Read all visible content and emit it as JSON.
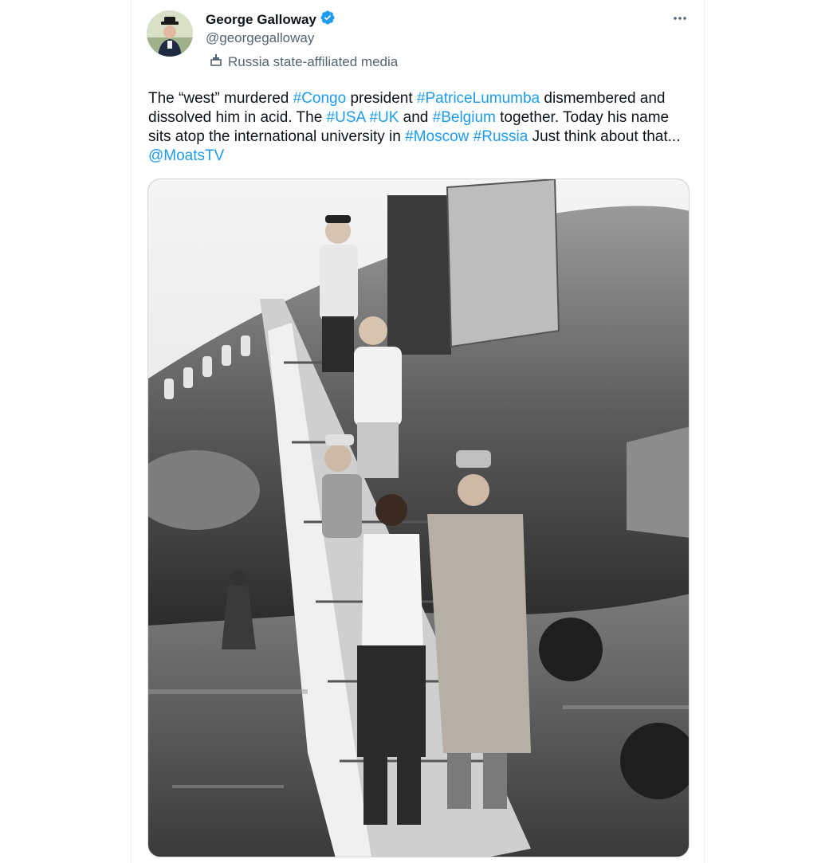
{
  "author": {
    "display_name": "George Galloway",
    "handle": "@georgegalloway",
    "verified": true,
    "affiliation": "Russia state-affiliated media",
    "affiliation_icon": "podium-icon"
  },
  "more_icon": "more-horizontal-icon",
  "tweet": {
    "segments": [
      {
        "text": "The “west” murdered ",
        "tag": false
      },
      {
        "text": "#Congo",
        "tag": true
      },
      {
        "text": " president ",
        "tag": false
      },
      {
        "text": "#PatriceLumumba",
        "tag": true
      },
      {
        "text": " dismembered and dissolved him in acid. The ",
        "tag": false
      },
      {
        "text": "#USA",
        "tag": true
      },
      {
        "text": " ",
        "tag": false
      },
      {
        "text": "#UK",
        "tag": true
      },
      {
        "text": " and ",
        "tag": false
      },
      {
        "text": "#Belgium",
        "tag": true
      },
      {
        "text": " together. Today his name sits atop the international university in ",
        "tag": false
      },
      {
        "text": "#Moscow",
        "tag": true
      },
      {
        "text": " ",
        "tag": false
      },
      {
        "text": "#Russia",
        "tag": true
      },
      {
        "text": " Just think about that... ",
        "tag": false
      },
      {
        "text": "@MoatsTV",
        "tag": true
      }
    ]
  },
  "colors": {
    "link": "#1d9bf0",
    "verified_badge": "#1d9bf0",
    "secondary_text": "#536471"
  }
}
